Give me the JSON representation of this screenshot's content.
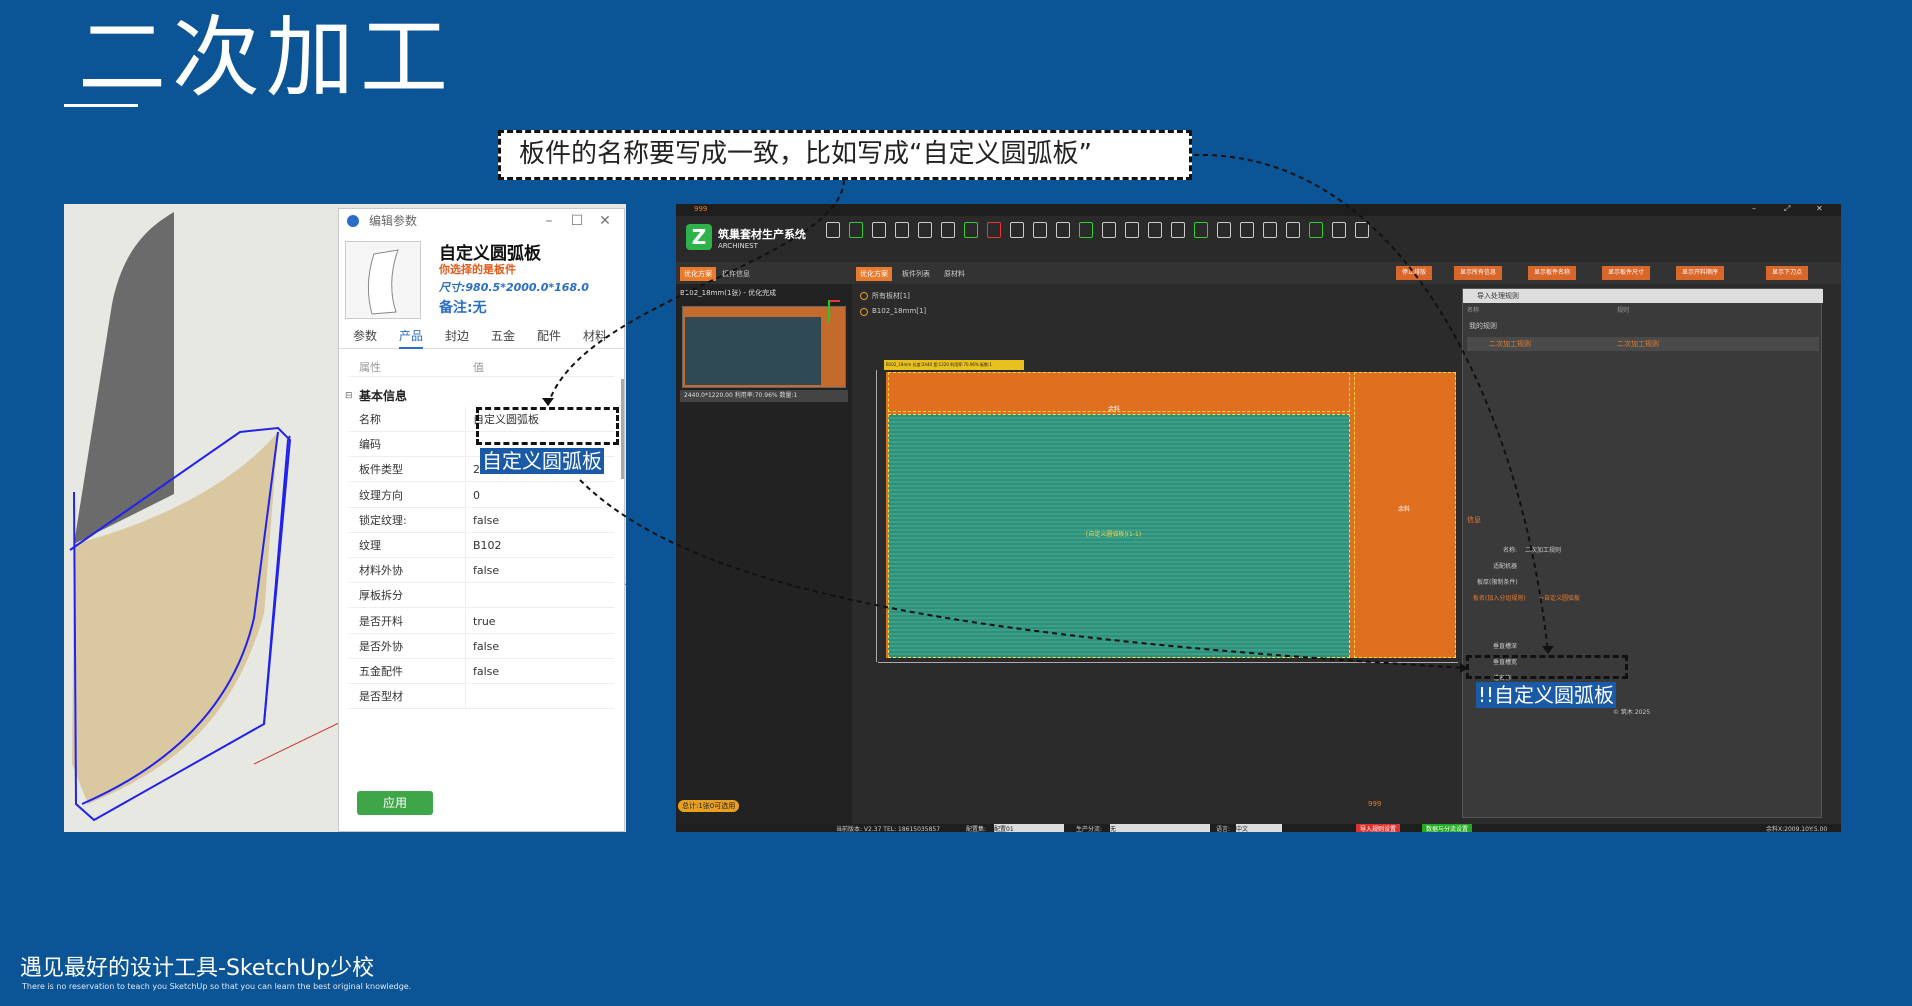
{
  "slide": {
    "title": "二次加工",
    "callout": "板件的名称要写成一致，比如写成“自定义圆弧板”",
    "footer_cn": "遇见最好的设计工具-SketchUp少校",
    "footer_en": "There is no reservation to teach you SketchUp so that you can learn the best original knowledge."
  },
  "edit_dialog": {
    "title": "编辑参数",
    "product_name": "自定义圆弧板",
    "subtitle": "你选择的是板件",
    "size": "尺寸:980.5*2000.0*168.0",
    "note": "备注:无",
    "tabs": [
      "参数",
      "产品",
      "封边",
      "五金",
      "配件",
      "材料"
    ],
    "col_property": "属性",
    "col_value": "值",
    "group": "基本信息",
    "rows": [
      {
        "k": "名称",
        "v": "自定义圆弧板"
      },
      {
        "k": "编码",
        "v": ""
      },
      {
        "k": "板件类型",
        "v": "2"
      },
      {
        "k": "纹理方向",
        "v": "0"
      },
      {
        "k": "锁定纹理:",
        "v": "false"
      },
      {
        "k": "纹理",
        "v": "B102"
      },
      {
        "k": "材料外协",
        "v": "false"
      },
      {
        "k": "厚板拆分",
        "v": ""
      },
      {
        "k": "是否开料",
        "v": "true"
      },
      {
        "k": "是否外协",
        "v": "false"
      },
      {
        "k": "五金配件",
        "v": "false"
      },
      {
        "k": "是否型材",
        "v": ""
      }
    ],
    "apply": "应用",
    "highlight_label": "自定义圆弧板"
  },
  "app": {
    "title_num": "999",
    "name": "筑巢套材生产系统",
    "name_en": "ARCHINEST",
    "tabs_left": [
      "优化方案",
      "板件信息"
    ],
    "tabs_main": [
      "优化方案",
      "板件列表",
      "原材料"
    ],
    "orange_buttons": [
      "停止排版",
      "显示所有信息",
      "显示板件名称",
      "显示板件尺寸",
      "显示开料顺序",
      "显示下刀点"
    ],
    "sheet_header": "B102_18mm(1张) - 优化完成",
    "sheet_caption": "2440.0*1220.00 利用率:70.96% 数量:1",
    "radio_all": "所有板材[1]",
    "radio_b102": "B102_18mm[1]",
    "board_waste1": "余料",
    "board_waste2": "余料",
    "board_part": "[自定义圆弧板](1-1)",
    "board_header": "B102_18mm 长度:2440 宽:1220 利用率:70.96% 板数:1",
    "total": "总计:1张0可选用",
    "bottom_num": "999",
    "status": "当前版本: V2.37 TEL: 18615035857",
    "config_label": "配置集:",
    "config_value": "配置01",
    "prod_label": "生产分流:",
    "prod_value": "无",
    "lang_label": "语言:",
    "lang_value": "中文",
    "btn_import": "导入规则设置",
    "btn_data": "数据与分流设置",
    "remain": "余料X:2009.10Y:5.00",
    "right_dialog": {
      "title": "导入处理规则",
      "col1": "名称",
      "col2": "规则",
      "folder": "我的规则",
      "rule": "二次加工规则",
      "rule_value": "二次加工规则",
      "info_tab": "信息",
      "field_name_label": "名称:",
      "field_name_value": "二次加工规则",
      "field2": "适配机器",
      "field3": "板厚(限制条件)",
      "field4": "板名(加入分组规则)",
      "field4_value": "=自定义圆弧板",
      "field5": "垂直槽深",
      "field6": "垂直槽宽",
      "field7": "槽名称",
      "save": "保存",
      "copyright": "© 筑木 2025"
    },
    "highlight_label": "!!自定义圆弧板"
  }
}
